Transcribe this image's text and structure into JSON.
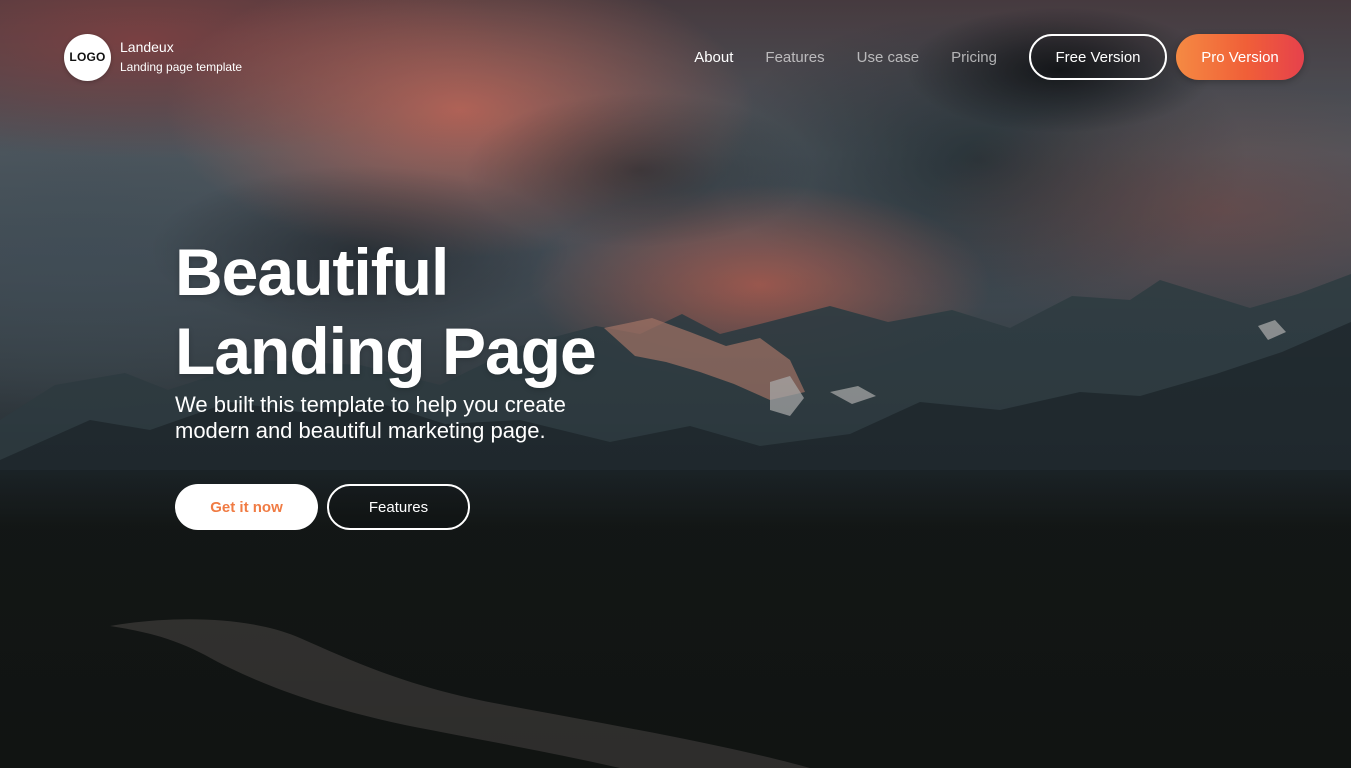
{
  "brand": {
    "logo_text": "LOGO",
    "name": "Landeux",
    "subtitle": "Landing page template"
  },
  "nav": {
    "items": [
      {
        "label": "About",
        "active": true
      },
      {
        "label": "Features",
        "active": false
      },
      {
        "label": "Use case",
        "active": false
      },
      {
        "label": "Pricing",
        "active": false
      }
    ],
    "free_button": "Free Version",
    "pro_button": "Pro Version"
  },
  "hero": {
    "title_line1": "Beautiful",
    "title_line2": "Landing Page",
    "subtitle_line1": "We built this template to help you create",
    "subtitle_line2": "modern and beautiful marketing page.",
    "primary_button": "Get it now",
    "secondary_button": "Features"
  },
  "colors": {
    "accent_orange": "#f07b43",
    "pro_gradient_start": "#f58a43",
    "pro_gradient_end": "#e6414c",
    "white": "#ffffff"
  }
}
